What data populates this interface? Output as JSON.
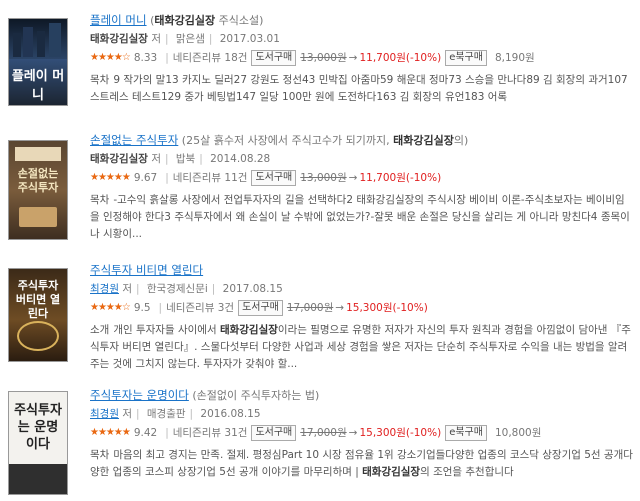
{
  "books": [
    {
      "title": "플레이 머니",
      "subtitle_open": "(",
      "keyword": "태화강김실장",
      "subtitle_rest": " 주식소설)",
      "author": "태화강김실장",
      "author_role": "저",
      "publisher": "맑은샘",
      "date": "2017.03.01",
      "stars": "★★★★☆",
      "rating": "8.33",
      "reviews": "네티즌리뷰 18건",
      "buy_label": "도서구매",
      "orig_price": "13,000원",
      "arrow": "→",
      "sale_price": "11,700원(-10%)",
      "ebook_label": "e북구매",
      "ebook_price": "8,190원",
      "desc_label": "목차",
      "desc": "9 작가의 말13 카지노 딜러27 강원도 정선43 민박집 아줌마59 해운대 정마73 스승을 만나다89 김 회장의 과거107 스트레스 테스트129 중가 베팅법147 일당 100만 원에 도전하다163 김 회장의 유언183 어록",
      "cover_text": "플레이 머니"
    },
    {
      "title": "손절없는 주식투자",
      "subtitle_open": "(25살 흙수저 사장에서 주식고수가 되기까지, ",
      "keyword": "태화강김실장",
      "subtitle_rest": "의)",
      "author": "태화강김실장",
      "author_role": "저",
      "publisher": "밥북",
      "date": "2014.08.28",
      "stars": "★★★★★",
      "rating": "9.67",
      "reviews": "네티즌리뷰 11건",
      "buy_label": "도서구매",
      "orig_price": "13,000원",
      "arrow": "→",
      "sale_price": "11,700원(-10%)",
      "desc_label": "목차",
      "desc": "-고수익 흙살롱 사장에서 전업투자자의 길을 선택하다2 태화강김실장의 주식시장 베이비 이론-주식초보자는 베이비임을 인정해야 한다3 주식투자에서 왜 손실이 날 수밖에 없었는가?-잘못 배운 손절은 당신을 살리는 게 아니라 망친다4 종목이나 시황이...",
      "cover_text": "손절없는 주식투자"
    },
    {
      "title": "주식투자 비티면 열린다",
      "author": "최경원",
      "author_role": "저",
      "publisher": "한국경제신문i",
      "date": "2017.08.15",
      "stars": "★★★★☆",
      "rating": "9.5",
      "reviews": "네티즌리뷰 3건",
      "buy_label": "도서구매",
      "orig_price": "17,000원",
      "arrow": "→",
      "sale_price": "15,300원(-10%)",
      "desc_label": "소개",
      "desc_pre": "개인 투자자들 사이에서 ",
      "keyword": "태화강김실장",
      "desc_post": "이라는 필명으로 유명한 저자가 자신의 투자 원칙과 경험을 아낌없이 담아낸 『주식투자 버티면 열린다』. 스물다섯부터 다양한 사업과 세상 경험을 쌓은 저자는 단순히 주식투자로 수익을 내는 방법을 알려주는 것에 그치지 않는다. 투자자가 갖춰야 할...",
      "cover_text": "주식투자 버티면 열린다"
    },
    {
      "title": "주식투자는 운명이다",
      "subtitle_open": "(손절없이 주식투자하는 법)",
      "author": "최경원",
      "author_role": "저",
      "publisher": "매경출판",
      "date": "2016.08.15",
      "stars": "★★★★★",
      "rating": "9.42",
      "reviews": "네티즌리뷰 31건",
      "buy_label": "도서구매",
      "orig_price": "17,000원",
      "arrow": "→",
      "sale_price": "15,300원(-10%)",
      "ebook_label": "e북구매",
      "ebook_price": "10,800원",
      "desc_label": "목차",
      "desc_pre": "마음의 최고 경지는 만족. 절제. 평정심Part 10 시장 점유율 1위 강소기업들다양한 업종의 코스닥 상장기업 5선 공개다양한 업종의 코스피 상장기업 5선 공개 이야기를 마무리하며 | ",
      "keyword": "태화강김실장",
      "desc_post": "의 조언을 추천합니다",
      "cover_text": "주식투자는 운명이다"
    }
  ],
  "colors": {
    "link": "#1a73c8",
    "sale": "#e02020",
    "stars": "#e96812"
  }
}
